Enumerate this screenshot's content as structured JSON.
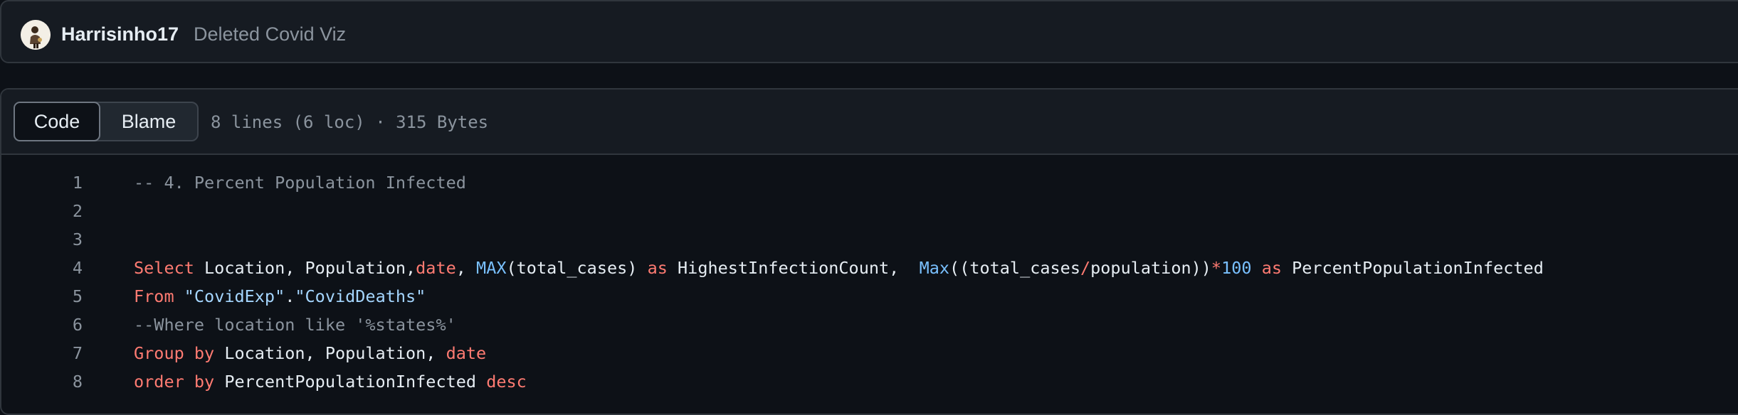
{
  "commit": {
    "author": "Harrisinho17",
    "message": "Deleted Covid Viz"
  },
  "file_header": {
    "tabs": [
      {
        "label": "Code",
        "active": true
      },
      {
        "label": "Blame",
        "active": false
      }
    ],
    "meta": "8 lines (6 loc) · 315 Bytes"
  },
  "code": {
    "lines": [
      {
        "num": "1",
        "tokens": [
          {
            "t": "cm",
            "v": "-- 4. Percent Population Infected"
          }
        ]
      },
      {
        "num": "2",
        "tokens": []
      },
      {
        "num": "3",
        "tokens": []
      },
      {
        "num": "4",
        "tokens": [
          {
            "t": "kw",
            "v": "Select"
          },
          {
            "t": "tx",
            "v": " Location, Population,"
          },
          {
            "t": "kw",
            "v": "date"
          },
          {
            "t": "tx",
            "v": ", "
          },
          {
            "t": "fn",
            "v": "MAX"
          },
          {
            "t": "tx",
            "v": "(total_cases) "
          },
          {
            "t": "kw",
            "v": "as"
          },
          {
            "t": "tx",
            "v": " HighestInfectionCount,  "
          },
          {
            "t": "fn",
            "v": "Max"
          },
          {
            "t": "tx",
            "v": "((total_cases"
          },
          {
            "t": "kw",
            "v": "/"
          },
          {
            "t": "tx",
            "v": "population))"
          },
          {
            "t": "kw",
            "v": "*"
          },
          {
            "t": "fn",
            "v": "100"
          },
          {
            "t": "tx",
            "v": " "
          },
          {
            "t": "kw",
            "v": "as"
          },
          {
            "t": "tx",
            "v": " PercentPopulationInfected"
          }
        ]
      },
      {
        "num": "5",
        "tokens": [
          {
            "t": "kw",
            "v": "From"
          },
          {
            "t": "tx",
            "v": " "
          },
          {
            "t": "st",
            "v": "\"CovidExp\""
          },
          {
            "t": "tx",
            "v": "."
          },
          {
            "t": "st",
            "v": "\"CovidDeaths\""
          }
        ]
      },
      {
        "num": "6",
        "tokens": [
          {
            "t": "cm",
            "v": "--Where location like '%states%'"
          }
        ]
      },
      {
        "num": "7",
        "tokens": [
          {
            "t": "kw",
            "v": "Group by"
          },
          {
            "t": "tx",
            "v": " Location, Population, "
          },
          {
            "t": "kw",
            "v": "date"
          }
        ]
      },
      {
        "num": "8",
        "tokens": [
          {
            "t": "kw",
            "v": "order by"
          },
          {
            "t": "tx",
            "v": " PercentPopulationInfected "
          },
          {
            "t": "kw",
            "v": "desc"
          }
        ]
      }
    ]
  },
  "colors": {
    "background": "#0d1117",
    "panel": "#161b22",
    "border": "#30363d",
    "keyword": "#ff7b72",
    "function": "#79c0ff",
    "string": "#a5d6ff",
    "comment": "#8b949e",
    "text": "#e6edf3"
  },
  "icons": {
    "avatar": "user-avatar"
  }
}
